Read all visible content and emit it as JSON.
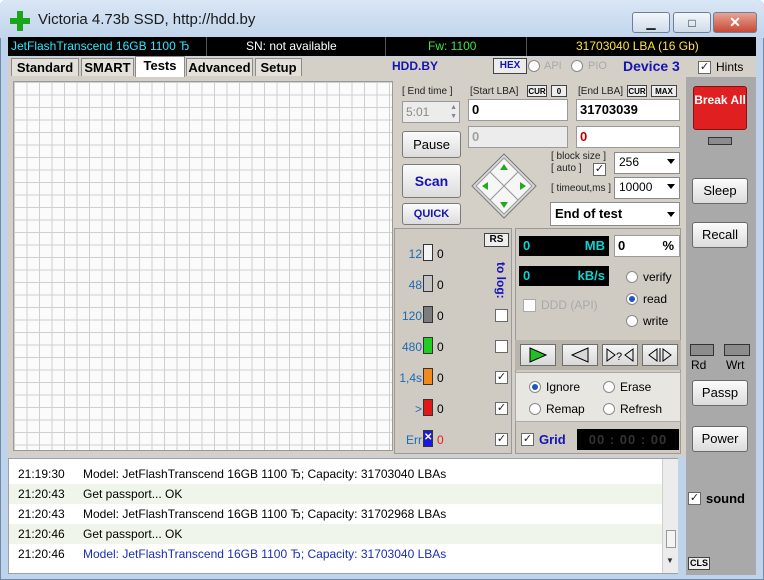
{
  "window": {
    "title": "Victoria 4.73b SSD, http://hdd.by",
    "minimize_glyph": "▁",
    "maximize_glyph": "□",
    "close_glyph": "✕"
  },
  "infobar": {
    "device": "JetFlashTranscend 16GB  1100 Ђ",
    "serial": "SN: not available",
    "firmware": "Fw: 1100",
    "capacity": "31703040 LBA (16 Gb)"
  },
  "tabs": [
    "Standard",
    "SMART",
    "Tests",
    "Advanced",
    "Setup"
  ],
  "active_tab": "Tests",
  "topbar": {
    "site": "HDD.BY",
    "hex_label": "HEX",
    "api_label": "API",
    "pio_label": "PIO",
    "device_label": "Device 3",
    "hints_label": "Hints"
  },
  "test_controls": {
    "end_time_label": "[ End time ]",
    "end_time_value": "5:01",
    "start_lba_label": "[Start LBA]",
    "start_lba_value": "0",
    "start_lba_disabled_value": "0",
    "end_lba_label": "[End LBA]",
    "end_lba_value": "31703039",
    "end_lba_second_value": "0",
    "cur_label": "CUR",
    "zero_label": "0",
    "max_label": "MAX",
    "pause_label": "Pause",
    "scan_label": "Scan",
    "quick_label": "QUICK",
    "block_size_label": "[ block size ]",
    "auto_label": "[ auto ]",
    "block_size_value": "256",
    "timeout_label": "[ timeout,ms ]",
    "timeout_value": "10000",
    "mode_value": "End of test"
  },
  "counters": {
    "rs_label": "RS",
    "to_log_label": "to log:",
    "rows": [
      {
        "label": "12",
        "value": "0",
        "color": "#f4f4f4",
        "log": false
      },
      {
        "label": "48",
        "value": "0",
        "color": "#c4c4c4",
        "log": false
      },
      {
        "label": "120",
        "value": "0",
        "color": "#7c7c7c",
        "log": false
      },
      {
        "label": "480",
        "value": "0",
        "color": "#22cc22",
        "log": false
      },
      {
        "label": "1,4s",
        "value": "0",
        "color": "#f08a1a",
        "log": true
      },
      {
        "label": ">",
        "value": "0",
        "color": "#e01818",
        "log": true
      },
      {
        "label": "Err",
        "value": "0",
        "color": "#1818e0",
        "log": true
      }
    ]
  },
  "progress": {
    "mb_value": "0",
    "mb_unit": "MB",
    "percent_value": "0",
    "percent_unit": "%",
    "speed_value": "0",
    "speed_unit": "kB/s",
    "ddd_label": "DDD (API)",
    "verify_label": "verify",
    "read_label": "read",
    "write_label": "write",
    "selected_mode": "read"
  },
  "actions": {
    "ignore_label": "Ignore",
    "erase_label": "Erase",
    "remap_label": "Remap",
    "refresh_label": "Refresh",
    "selected": "Ignore",
    "grid_label": "Grid",
    "timer_value": "00 : 00 : 00"
  },
  "side_buttons": {
    "break_all_label": "Break All",
    "sleep_label": "Sleep",
    "recall_label": "Recall",
    "rd_label": "Rd",
    "wrt_label": "Wrt",
    "passp_label": "Passp",
    "power_label": "Power",
    "sound_label": "sound",
    "cls_label": "CLS"
  },
  "log": [
    {
      "time": "21:19:30",
      "text": "Model: JetFlashTranscend 16GB  1100 Ђ; Capacity: 31703040 LBAs",
      "highlight": false
    },
    {
      "time": "21:20:43",
      "text": "Get passport... OK",
      "highlight": false
    },
    {
      "time": "21:20:43",
      "text": "Model: JetFlashTranscend 16GB  1100 Ђ; Capacity: 31702968 LBAs",
      "highlight": false
    },
    {
      "time": "21:20:46",
      "text": "Get passport... OK",
      "highlight": false
    },
    {
      "time": "21:20:46",
      "text": "Model: JetFlashTranscend 16GB  1100 Ђ; Capacity: 31703040 LBAs",
      "highlight": true
    }
  ],
  "colors": {
    "accent_blue": "#1414b4",
    "break_red": "#e02020",
    "log_highlight": "#1a2cb8"
  }
}
